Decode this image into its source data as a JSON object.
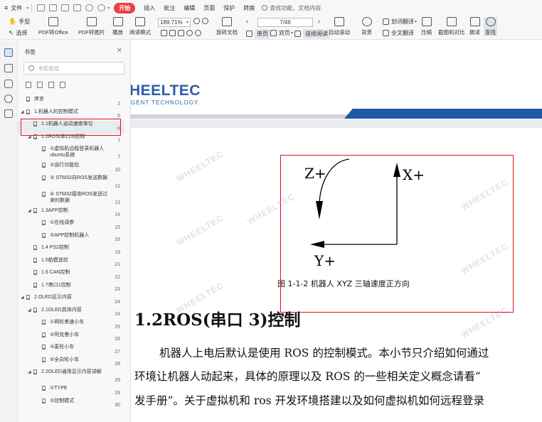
{
  "menu": {
    "file": "文件",
    "start": "开始",
    "insert": "插入",
    "annotate": "批注",
    "edit": "编辑",
    "page": "页面",
    "protect": "保护",
    "convert": "转换",
    "search_placeholder": "查找功能、文档内容"
  },
  "toolbar": {
    "hand": "手型",
    "select": "选择",
    "pdf_to_office": "PDF转Office",
    "pdf_to_image": "PDF转图片",
    "play": "播放",
    "read_mode": "阅读模式",
    "zoom": "189.71%",
    "rotate_doc": "旋转文档",
    "page_indicator": "7/46",
    "single_page": "单页",
    "double_page": "双页",
    "continuous": "连续阅读",
    "auto_scroll": "自动滚动",
    "background": "背景",
    "translate_words": "划词翻译",
    "full_translate": "全文翻译",
    "compress": "压缩",
    "screenshot_compare": "截图和对比",
    "read_aloud": "朗读",
    "find": "查找"
  },
  "bookmarks": {
    "title": "书签",
    "search_placeholder": "书签查找",
    "items": [
      {
        "label": "序言",
        "page": "2",
        "level": 0,
        "arrow": ""
      },
      {
        "label": "1.机器人的控制模式",
        "page": "6",
        "level": 0,
        "arrow": "◢"
      },
      {
        "label": "1.1机器人运动速度单位",
        "page": "6",
        "level": 1,
        "arrow": ""
      },
      {
        "label": "1.2ROS(串口3)控制",
        "page": "7",
        "level": 1,
        "arrow": "◢"
      },
      {
        "label": "①虚拟机远程登录机器人ubuntu系统",
        "page": "7",
        "level": 2,
        "arrow": ""
      },
      {
        "label": "②运行功能包",
        "page": "10",
        "level": 2,
        "arrow": ""
      },
      {
        "label": "③ STM32向ROS发送数据",
        "page": "11",
        "level": 2,
        "arrow": ""
      },
      {
        "label": "④ STM32接收ROS发送过来的数据",
        "page": "13",
        "level": 2,
        "arrow": ""
      },
      {
        "label": "1.3APP控制",
        "page": "14",
        "level": 1,
        "arrow": "◢"
      },
      {
        "label": "①在线调参",
        "page": "15",
        "level": 2,
        "arrow": ""
      },
      {
        "label": "②APP控制机器人",
        "page": "16",
        "level": 2,
        "arrow": ""
      },
      {
        "label": "1.4 PS2控制",
        "page": "19",
        "level": 1,
        "arrow": ""
      },
      {
        "label": "1.5航模遥控",
        "page": "21",
        "level": 1,
        "arrow": ""
      },
      {
        "label": "1.6 CAN控制",
        "page": "22",
        "level": 1,
        "arrow": ""
      },
      {
        "label": "1.7串口1控制",
        "page": "23",
        "level": 1,
        "arrow": ""
      },
      {
        "label": "2.OLED显示内容",
        "page": "24",
        "level": 0,
        "arrow": "◢"
      },
      {
        "label": "2.1OLED具体内容",
        "page": "24",
        "level": 1,
        "arrow": "◢"
      },
      {
        "label": "①两轮差速小车",
        "page": "25",
        "level": 2,
        "arrow": ""
      },
      {
        "label": "②阿克曼小车",
        "page": "26",
        "level": 2,
        "arrow": ""
      },
      {
        "label": "③麦轮小车",
        "page": "27",
        "level": 2,
        "arrow": ""
      },
      {
        "label": "④全向轮小车",
        "page": "28",
        "level": 2,
        "arrow": ""
      },
      {
        "label": "2.2OLED通用显示内容讲解",
        "page": "29",
        "level": 1,
        "arrow": "◢"
      },
      {
        "label": "①TYPE",
        "page": "29",
        "level": 2,
        "arrow": ""
      },
      {
        "label": "②控制模式",
        "page": "30",
        "level": 2,
        "arrow": ""
      }
    ]
  },
  "document": {
    "logo": "HEELTEC",
    "logo_sub": "GENT TECHNOLOGY",
    "watermark": "WHEELTEC",
    "figure": {
      "z_label": "Z+",
      "x_label": "X+",
      "y_label": "Y+",
      "caption": "图  1-1-2  机器人 XYZ 三轴速度正方向"
    },
    "heading": "1.2ROS(串口 3)控制",
    "paragraphs": [
      "机器人上电后默认是使用 ROS 的控制模式。本小节只介绍如何通过",
      "环境让机器人动起来，具体的原理以及 ROS 的一些相关定义概念请看“",
      "发手册”。关于虚拟机和 ros 开发环境搭建以及如何虚拟机如何远程登录"
    ]
  }
}
